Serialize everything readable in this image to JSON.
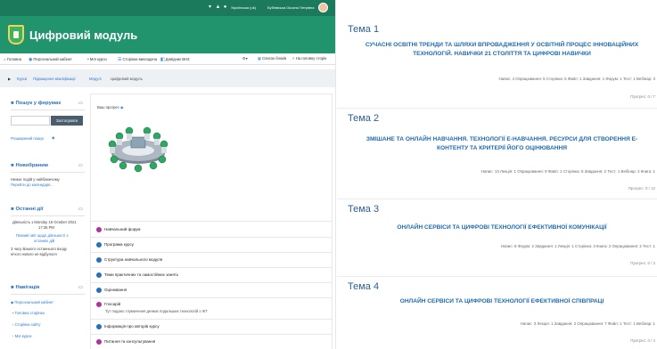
{
  "header": {
    "user_lang": "Українська (uk)",
    "user_name": "Бубнівська Оксана Петрівна"
  },
  "brand": {
    "title": "Цифровий модуль"
  },
  "nav": {
    "items": [
      "Головна",
      "Персональний кабінет",
      "Мої курси",
      "Сторінки викладача",
      "Довідник ВНЗ"
    ],
    "right": [
      "Список блоків",
      "На головну сторін"
    ]
  },
  "breadcrumbs": [
    "Курси",
    "Підвищення кваліфікації",
    "Модулі",
    "Цифровий модуль"
  ],
  "sidebar": {
    "search": {
      "title": "Пошук у форумах",
      "button": "Застосувати",
      "advanced": "Розширений пошук"
    },
    "news": {
      "title": "Новобраним",
      "text1": "Немає подій у найближчому",
      "text2": "Перейти до календаря..."
    },
    "recent": {
      "title": "Останні дії",
      "date1": "Діяльність з Monday 18 October 2021",
      "date2": "17:35 PM",
      "link1": "Повний звіт щодо діяльності з",
      "link2": "останніх дій",
      "text1": "З часу Вашого останнього входу",
      "text2": "нічого нового не відбулося"
    },
    "navigation": {
      "title": "Навігація",
      "items": [
        "Персональний кабінет",
        "Головна сторінка",
        "Сторінки сайту",
        "Мої курси"
      ]
    }
  },
  "main": {
    "intro": "Ваш прогрес",
    "activities": [
      {
        "label": "Навчальний форум",
        "color": "#b0339b"
      },
      {
        "label": "Програма курсу",
        "color": "#2a6fb8"
      },
      {
        "label": "Структура навчального модуля",
        "color": "#2a6fb8"
      },
      {
        "label": "Теми практичних та самостійних занять",
        "color": "#2a6fb8"
      },
      {
        "label": "Оцінювання",
        "color": "#2a6fb8"
      },
      {
        "label": "Глосарій",
        "color": "#b0339b"
      },
      {
        "label": "Інформація про авторів курсу",
        "color": "#2a6fb8"
      },
      {
        "label": "Питання та консультування",
        "color": "#b0339b"
      }
    ],
    "glossary_note": "Тут подано тлумачення деяких подальших технологій з ІКТ"
  },
  "sections": [
    {
      "heading": "Тема 1",
      "title": "СУЧАСНІ ОСВІТНІ ТРЕНДИ ТА ШЛЯХИ ВПРОВАДЖЕННЯ У ОСВІТНІЙ ПРОЦЕС ІННОВАЦІЙНИХ ТЕХНОЛОГІЙ. НАВИЧКИ 21 СТОЛІТТЯ ТА ЦИФРОВІ НАВИЧКИ",
      "stats": "Напис: 4  Опрацювання: 5  Сторінка: 5  Файл: 1  Завдання: 1  Форум: 1  Тест: 1  Вебінар: 3",
      "progress": "Прогрес: 0 / 7"
    },
    {
      "heading": "Тема 2",
      "title": "ЗМІШАНЕ ТА ОНЛАЙН НАВЧАННЯ. ТЕХНОЛОГІЇ Е-НАВЧАННЯ. РЕСУРСИ ДЛЯ СТВОРЕННЯ Е-КОНТЕНТУ ТА КРИТЕРІЇ ЙОГО ОЦІНЮВАННЯ",
      "stats": "Напис: 13  Лекція: 1  Опрацювання: 9  Файл: 1  Сторінка: 8  Завдання: 2  Тест: 1  Вебінар: 2  Книга: 1",
      "progress": "Прогрес: 0 / 12"
    },
    {
      "heading": "Тема 3",
      "title": "ОНЛАЙН СЕРВІСИ ТА ЦИФРОВІ ТЕХНОЛОГІЇ ЕФЕКТИВНОЇ КОМУНІКАЦІЇ",
      "stats": "Напис: 8  Форум: 2  Завдання: 1  Лекція: 1  Сторінка: 3  Книга: 2  Опрацювання: 2  Тест: 1",
      "progress": "Прогрес: 0 / 3"
    },
    {
      "heading": "Тема 4",
      "title": "ОНЛАЙН СЕРВІСИ ТА ЦИФРОВІ ТЕХНОЛОГІЇ ЕФЕКТИВНОЇ СПІВПРАЦІ",
      "stats": "Напис: 3  Лекція: 1  Завдання: 2  Опрацювання: 7  Файл: 1  Тест: 1  Вебінар: 1",
      "progress": "Прогрес: 0 / 4"
    }
  ]
}
